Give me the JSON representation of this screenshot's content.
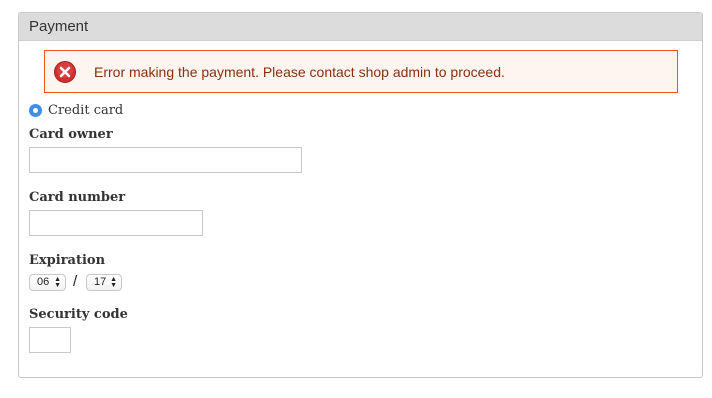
{
  "payment": {
    "legend": "Payment",
    "error_message": "Error making the payment. Please contact shop admin to proceed.",
    "method": {
      "label": "Credit card",
      "selected": true
    },
    "fields": {
      "card_owner_label": "Card owner",
      "card_owner_value": "",
      "card_number_label": "Card number",
      "card_number_value": "",
      "expiration_label": "Expiration",
      "expiration_month": "06",
      "expiration_separator": "/",
      "expiration_year": "17",
      "security_code_label": "Security code",
      "security_code_value": ""
    }
  },
  "icons": {
    "error": "error-x-icon",
    "select_arrows": "up-down-arrows-icon"
  },
  "colors": {
    "legend_bg": "#dcdcdc",
    "error_bg": "#fef5f1",
    "error_border": "#ed541d",
    "error_text": "#8c2e0b",
    "radio_accent": "#3d8fe8"
  }
}
